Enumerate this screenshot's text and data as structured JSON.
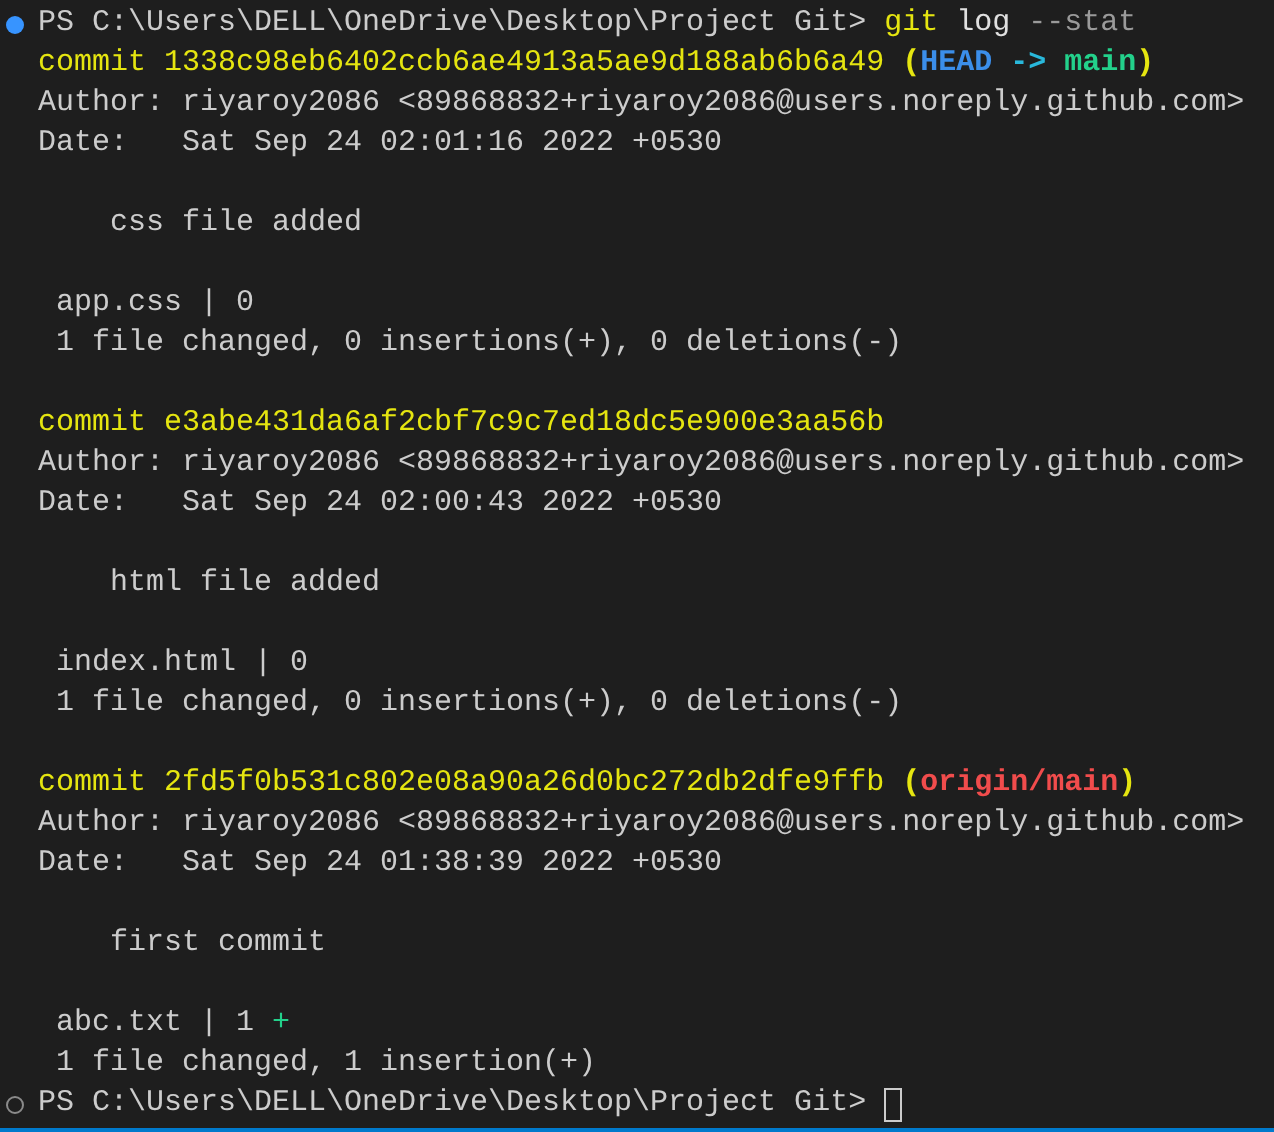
{
  "terminal": {
    "lines": [
      {
        "kind": "prompt",
        "active": true,
        "path": "PS C:\\Users\\DELL\\OneDrive\\Desktop\\Project Git>",
        "command": [
          {
            "text": "git",
            "color": "#e5e510"
          },
          {
            "text": "log",
            "color": "#e0e0e0"
          },
          {
            "text": "--stat",
            "color": "#9a9a9a"
          }
        ]
      },
      {
        "kind": "commit",
        "label": "commit 1338c98eb6402ccb6ae4913a5ae9d188ab6b6a49",
        "refs": [
          {
            "text": "(",
            "color": "#e5e510"
          },
          {
            "text": "HEAD",
            "color": "#3b8eea"
          },
          {
            "text": "->",
            "color": "#29b8db"
          },
          {
            "text": "main",
            "color": "#23d18b"
          },
          {
            "text": ")",
            "color": "#e5e510"
          }
        ]
      },
      {
        "kind": "text",
        "text": "Author: riyaroy2086 <89868832+riyaroy2086@users.noreply.github.com>"
      },
      {
        "kind": "text",
        "text": "Date:   Sat Sep 24 02:01:16 2022 +0530"
      },
      {
        "kind": "blank"
      },
      {
        "kind": "text",
        "text": "    css file added"
      },
      {
        "kind": "blank"
      },
      {
        "kind": "text",
        "text": " app.css | 0"
      },
      {
        "kind": "text",
        "text": " 1 file changed, 0 insertions(+), 0 deletions(-)"
      },
      {
        "kind": "blank"
      },
      {
        "kind": "commit",
        "label": "commit e3abe431da6af2cbf7c9c7ed18dc5e900e3aa56b"
      },
      {
        "kind": "text",
        "text": "Author: riyaroy2086 <89868832+riyaroy2086@users.noreply.github.com>"
      },
      {
        "kind": "text",
        "text": "Date:   Sat Sep 24 02:00:43 2022 +0530"
      },
      {
        "kind": "blank"
      },
      {
        "kind": "text",
        "text": "    html file added"
      },
      {
        "kind": "blank"
      },
      {
        "kind": "text",
        "text": " index.html | 0"
      },
      {
        "kind": "text",
        "text": " 1 file changed, 0 insertions(+), 0 deletions(-)"
      },
      {
        "kind": "blank"
      },
      {
        "kind": "commit",
        "label": "commit 2fd5f0b531c802e08a90a26d0bc272db2dfe9ffb",
        "refs": [
          {
            "text": "(",
            "color": "#e5e510"
          },
          {
            "text": "origin/main",
            "color": "#f14c4c"
          },
          {
            "text": ")",
            "color": "#e5e510"
          }
        ]
      },
      {
        "kind": "text",
        "text": "Author: riyaroy2086 <89868832+riyaroy2086@users.noreply.github.com>"
      },
      {
        "kind": "text",
        "text": "Date:   Sat Sep 24 01:38:39 2022 +0530"
      },
      {
        "kind": "blank"
      },
      {
        "kind": "text",
        "text": "    first commit"
      },
      {
        "kind": "blank"
      },
      {
        "kind": "stat",
        "text": " abc.txt | 1",
        "plus": "+"
      },
      {
        "kind": "text",
        "text": " 1 file changed, 1 insertion(+)"
      },
      {
        "kind": "prompt",
        "active": false,
        "path": "PS C:\\Users\\DELL\\OneDrive\\Desktop\\Project Git>",
        "cursor": true
      }
    ]
  }
}
